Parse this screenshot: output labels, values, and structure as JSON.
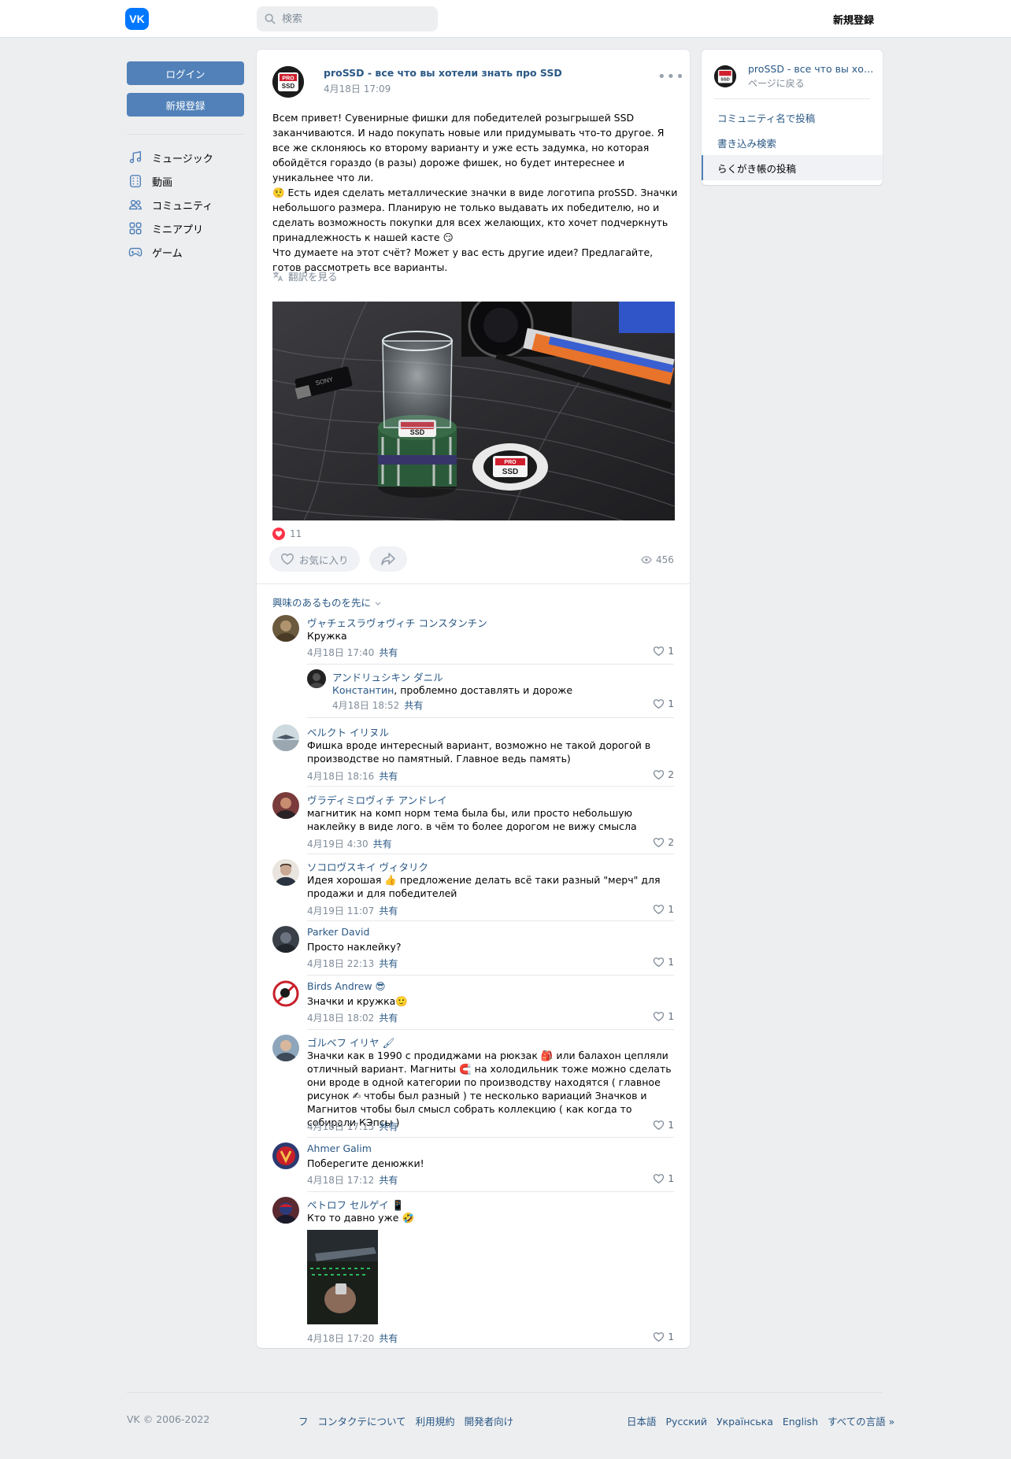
{
  "header": {
    "logo_text": "VK",
    "search_placeholder": "検索",
    "register_label": "新規登録"
  },
  "left": {
    "login_label": "ログイン",
    "register_label": "新規登録",
    "menu": [
      {
        "icon": "music-note-icon",
        "label": "ミュージック"
      },
      {
        "icon": "video-icon",
        "label": "動画"
      },
      {
        "icon": "users-icon",
        "label": "コミュニティ"
      },
      {
        "icon": "apps-icon",
        "label": "ミニアプリ"
      },
      {
        "icon": "gamepad-icon",
        "label": "ゲーム"
      }
    ]
  },
  "post": {
    "author": "proSSD - все что вы хотели знать про SSD",
    "date": "4月18日 17:09",
    "avatar_text_top": "PRO",
    "avatar_text_bottom": "SSD",
    "text": "Всем привет! Сувенирные фишки для победителей розыгрышей SSD заканчиваются. И надо покупать новые или придумывать что-то другое. Я все же склоняюсь ко второму варианту и уже есть задумка, но которая обойдётся гораздо (в разы) дороже фишек, но будет интереснее и уникальнее что ли.\n🤨 Есть идея сделать металлические значки в виде логотипа proSSD. Значки небольшого размера. Планирую не только выдавать их победителю, но и сделать возможность покупки для всех желающих, кто хочет подчеркнуть принадлежность к нашей касте 😏\nЧто думаете на этот счёт? Может у вас есть другие идеи? Предлагайте, готов рассмотреть все варианты.",
    "translate_label": "翻訳を見る",
    "likes_count": "11",
    "favorite_label": "お気に入り",
    "views_count": "456",
    "sort_label": "興味のあるものを先に"
  },
  "comments": [
    {
      "name": "ヴャチェスラヴォヴィチ コンスタンチン",
      "text": "Кружка",
      "date": "4月18日 17:40",
      "reply": "共有",
      "likes": "1",
      "avatar_color": "#6b5a3e"
    },
    {
      "name": "アンドリュシキン ダニル",
      "mention": "Константин",
      "text": ", проблемно доставлять и дороже",
      "date": "4月18日 18:52",
      "reply": "共有",
      "likes": "1",
      "avatar_color": "#222"
    },
    {
      "name": "ベルクト イリヌル",
      "text": "Фишка вроде интересный вариант, возможно не такой дорогой в производстве но памятный. Главное ведь память)",
      "date": "4月18日 18:16",
      "reply": "共有",
      "likes": "2",
      "avatar_color": "#9bb0c0"
    },
    {
      "name": "ヴラディミロヴィチ アンドレイ",
      "text": "магнитик на комп норм тема была бы, или просто небольшую наклейку в виде лого. в чём то более дорогом не вижу смысла",
      "date": "4月19日 4:30",
      "reply": "共有",
      "likes": "2",
      "avatar_color": "#7a3b3b"
    },
    {
      "name": "ソコロヴスキイ ヴィタリク",
      "text": "Идея хорошая 👍 предложение делать всё таки разный \"мерч\" для продажи и для победителей",
      "date": "4月19日 11:07",
      "reply": "共有",
      "likes": "1",
      "avatar_color": "#c9a894"
    },
    {
      "name": "Parker David",
      "text": "Просто наклейку?",
      "date": "4月18日 22:13",
      "reply": "共有",
      "likes": "1",
      "avatar_color": "#3a4048"
    },
    {
      "name": "Birds Andrew 😎",
      "text": "Значки и кружка🙂",
      "date": "4月18日 18:02",
      "reply": "共有",
      "likes": "1",
      "avatar_color": "#c8202a"
    },
    {
      "name": "ゴルベフ イリヤ 🖌",
      "text": "Значки как в 1990 с продиджами на рюкзак 🎒 или балахон цепляли отличный вариант. Магниты 🧲 на холодильник тоже можно сделать они вроде в одной категории по производству находятся ( главное рисунок ✍ чтобы был разный ) те несколько вариаций Значков и Магнитов чтобы был смысл собрать коллекцию ( как когда то собирали КЭпсы )",
      "date": "4月18日 17:15",
      "reply": "共有",
      "likes": "1",
      "avatar_color": "#8ea6bb"
    },
    {
      "name": "Ahmer Galim",
      "text": "Поберегите денюжки!",
      "date": "4月18日 17:12",
      "reply": "共有",
      "likes": "1",
      "avatar_color": "#2b3a70"
    },
    {
      "name": "ペトロフ セルゲイ 📱",
      "text": "Кто то давно уже 🤣",
      "date": "4月18日 17:20",
      "reply": "共有",
      "likes": "1",
      "avatar_color": "#5a2a30"
    }
  ],
  "right": {
    "title": "proSSD - все что вы хотели знать про SSD",
    "back_label": "ページに戻る",
    "items": [
      "コミュニティ名で投稿",
      "書き込み検索",
      "らくがき帳の投稿"
    ]
  },
  "footer": {
    "copyright": "VK © 2006-2022",
    "links": [
      "フ",
      "コンタクテについて",
      "利用規約",
      "開発者向け"
    ],
    "languages": [
      "日本語",
      "Русский",
      "Українська",
      "English",
      "すべての言語 »"
    ]
  }
}
